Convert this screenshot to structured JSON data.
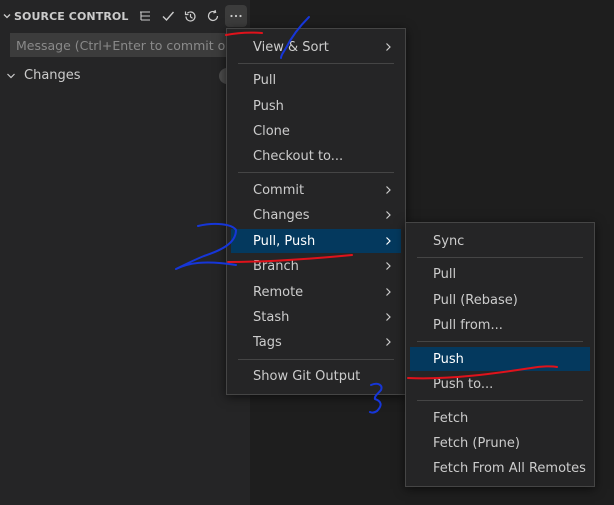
{
  "sidebar": {
    "title": "SOURCE CONTROL",
    "actions": [
      "view-as-tree-icon",
      "commit-check-icon",
      "history-icon",
      "refresh-icon",
      "more-actions-icon"
    ],
    "message_placeholder": "Message (Ctrl+Enter to commit on '...",
    "changes_label": "Changes"
  },
  "menu": {
    "items": [
      {
        "label": "View & Sort",
        "submenu": true
      },
      {
        "label": "Pull"
      },
      {
        "label": "Push"
      },
      {
        "label": "Clone"
      },
      {
        "label": "Checkout to..."
      },
      {
        "label": "Commit",
        "submenu": true
      },
      {
        "label": "Changes",
        "submenu": true
      },
      {
        "label": "Pull, Push",
        "submenu": true,
        "highlighted": true
      },
      {
        "label": "Branch",
        "submenu": true
      },
      {
        "label": "Remote",
        "submenu": true
      },
      {
        "label": "Stash",
        "submenu": true
      },
      {
        "label": "Tags",
        "submenu": true
      },
      {
        "label": "Show Git Output"
      }
    ]
  },
  "submenu": {
    "items": [
      {
        "label": "Sync"
      },
      {
        "label": "Pull"
      },
      {
        "label": "Pull (Rebase)"
      },
      {
        "label": "Pull from..."
      },
      {
        "label": "Push",
        "highlighted": true
      },
      {
        "label": "Push to..."
      },
      {
        "label": "Fetch"
      },
      {
        "label": "Fetch (Prune)"
      },
      {
        "label": "Fetch From All Remotes"
      }
    ]
  },
  "annotations": {
    "marks": [
      "1",
      "2",
      "3"
    ],
    "ink_colors": {
      "red": "#e0121b",
      "blue": "#1636d8"
    }
  },
  "colors": {
    "highlight": "#04395e",
    "menu_background": "#252526",
    "editor_background": "#1e1e1e"
  }
}
